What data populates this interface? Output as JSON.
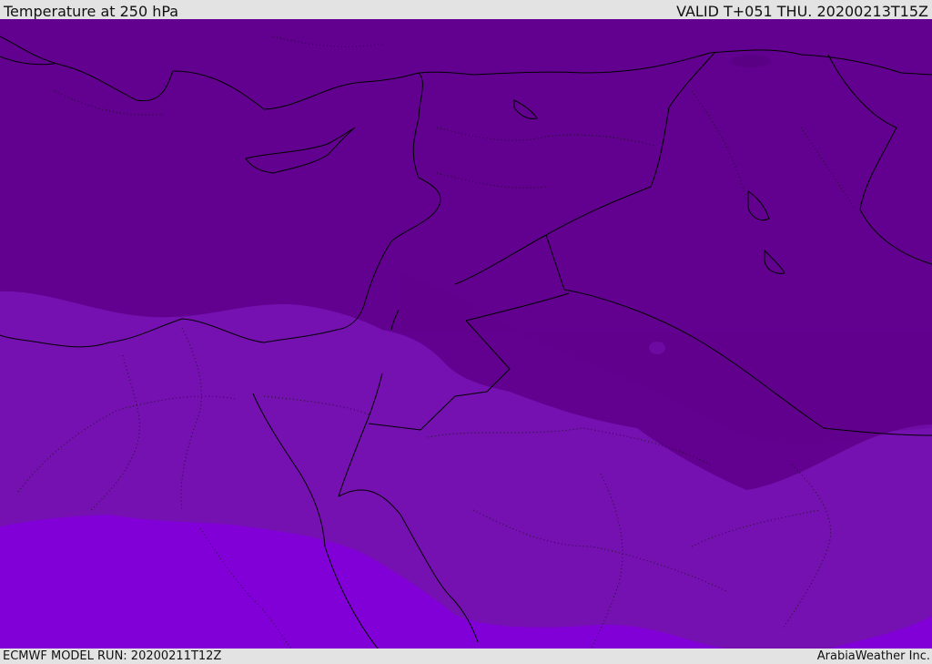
{
  "header": {
    "title": "Temperature at 250 hPa",
    "valid_time": "VALID T+051 THU. 20200213T15Z"
  },
  "footer": {
    "model_run": "ECMWF MODEL RUN: 20200211T12Z",
    "credit": "ArabiaWeather Inc."
  },
  "map": {
    "field": "temperature",
    "level_hpa": 250,
    "colors": {
      "coldest_band": "#62008f",
      "middle_band": "#7511b0",
      "warmest_band": "#8200d8",
      "cold_patch": "#5c0089",
      "coastline": "#000000"
    }
  }
}
